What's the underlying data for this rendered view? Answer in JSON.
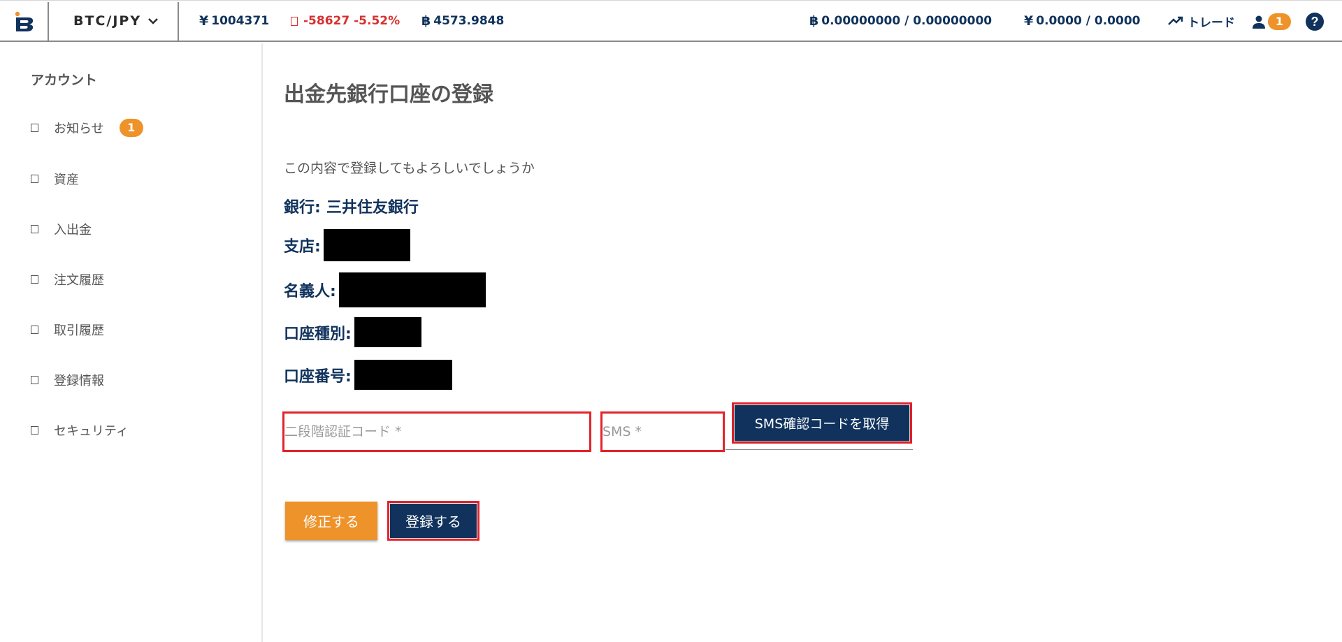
{
  "header": {
    "pair": "BTC/JPY",
    "jpy_symbol": "¥",
    "btc_symbol": "฿",
    "last_price": "1004371",
    "change": "-58627 -5.52%",
    "volume": "4573.9848",
    "btc_balance": "0.00000000 / 0.00000000",
    "jpy_balance": "0.0000 / 0.0000",
    "trade_label": "トレード",
    "user_badge": "1",
    "help_label": "?",
    "accent_color": "#10325c",
    "badge_color": "#ee922a",
    "negative_color": "#d7302f"
  },
  "sidebar": {
    "title": "アカウント",
    "items": [
      {
        "label": "お知らせ",
        "badge": "1"
      },
      {
        "label": "資産"
      },
      {
        "label": "入出金"
      },
      {
        "label": "注文履歴"
      },
      {
        "label": "取引履歴"
      },
      {
        "label": "登録情報"
      },
      {
        "label": "セキュリティ"
      }
    ]
  },
  "main": {
    "title": "出金先銀行口座の登録",
    "confirm_text": "この内容で登録してもよろしいでしょうか",
    "fields": [
      {
        "label": "銀行:",
        "value": "三井住友銀行"
      },
      {
        "label": "支店:",
        "value": ""
      },
      {
        "label": "名義人:",
        "value": ""
      },
      {
        "label": "口座種別:",
        "value": ""
      },
      {
        "label": "口座番号:",
        "value": ""
      }
    ],
    "twofa_placeholder": "二段階認証コード *",
    "sms_placeholder": "SMS *",
    "sms_button": "SMS確認コードを取得",
    "edit_button": "修正する",
    "register_button": "登録する",
    "highlight_color": "#e2232b"
  }
}
